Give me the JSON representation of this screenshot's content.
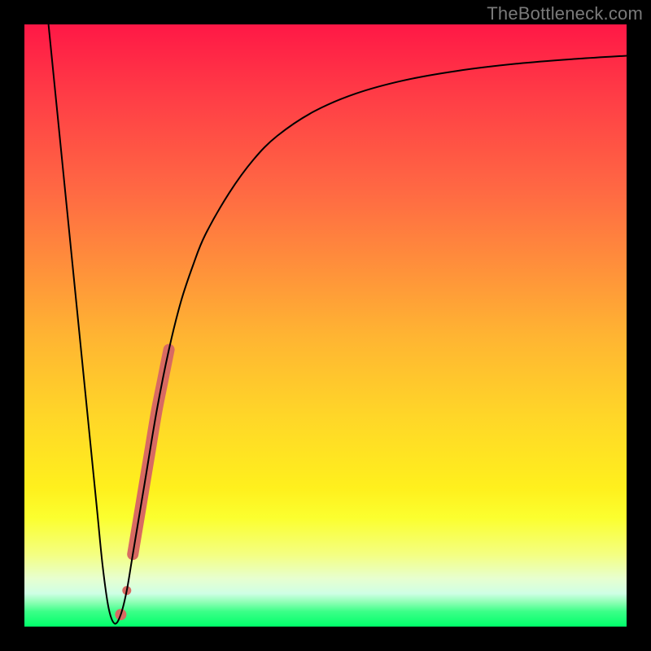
{
  "watermark": "TheBottleneck.com",
  "chart_data": {
    "type": "line",
    "title": "",
    "xlabel": "",
    "ylabel": "",
    "xlim": [
      0,
      100
    ],
    "ylim": [
      0,
      100
    ],
    "grid": false,
    "series": [
      {
        "name": "bottleneck-curve",
        "color": "#000000",
        "stroke_width": 2,
        "x": [
          4,
          6,
          8,
          10,
          12,
          13,
          14,
          15,
          16,
          17,
          18,
          20,
          22,
          24,
          26,
          28,
          30,
          34,
          38,
          42,
          48,
          55,
          63,
          72,
          82,
          92,
          100
        ],
        "y": [
          100,
          80,
          60,
          40,
          20,
          10,
          3,
          0.5,
          2,
          6,
          12,
          24,
          36,
          46,
          54,
          60,
          65,
          72,
          77.5,
          81.5,
          85.5,
          88.5,
          90.7,
          92.3,
          93.5,
          94.3,
          94.8
        ]
      },
      {
        "name": "highlight-segment",
        "color": "#d86a62",
        "stroke_width": 14,
        "x": [
          18,
          19,
          20,
          21,
          22,
          23,
          24
        ],
        "y": [
          12,
          18,
          24,
          30,
          36,
          41,
          46
        ]
      },
      {
        "name": "highlight-dot",
        "color": "#d86a62",
        "stroke_width": 14,
        "x": [
          16
        ],
        "y": [
          2
        ]
      },
      {
        "name": "highlight-dot-2",
        "color": "#d86a62",
        "stroke_width": 11,
        "x": [
          17
        ],
        "y": [
          6
        ]
      }
    ],
    "background_gradient_stops": [
      {
        "pos": 0.0,
        "color": "#ff1846"
      },
      {
        "pos": 0.12,
        "color": "#ff3d46"
      },
      {
        "pos": 0.28,
        "color": "#ff6a43"
      },
      {
        "pos": 0.4,
        "color": "#ff8f3b"
      },
      {
        "pos": 0.52,
        "color": "#ffb532"
      },
      {
        "pos": 0.65,
        "color": "#ffd628"
      },
      {
        "pos": 0.77,
        "color": "#fff01d"
      },
      {
        "pos": 0.82,
        "color": "#fbff2f"
      },
      {
        "pos": 0.88,
        "color": "#f4ff81"
      },
      {
        "pos": 0.92,
        "color": "#e7ffcf"
      },
      {
        "pos": 0.945,
        "color": "#cfffe5"
      },
      {
        "pos": 0.96,
        "color": "#8cffb4"
      },
      {
        "pos": 0.975,
        "color": "#3cff88"
      },
      {
        "pos": 1.0,
        "color": "#00ff6a"
      }
    ]
  }
}
